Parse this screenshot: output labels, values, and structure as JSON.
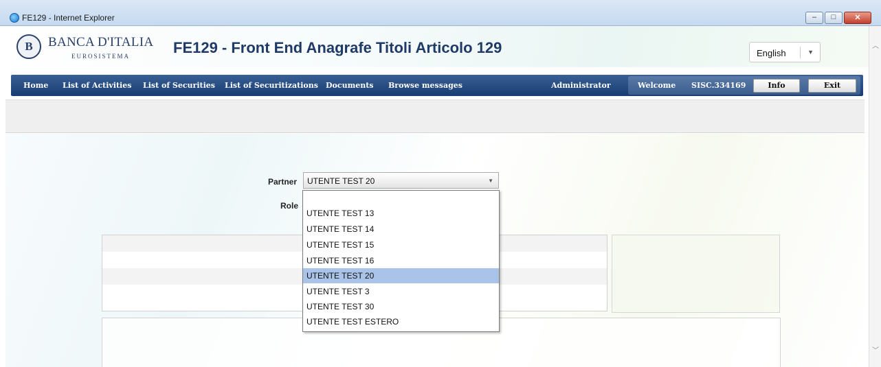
{
  "window": {
    "title": "FE129 - Internet Explorer"
  },
  "header": {
    "bank_name": "BANCA D'ITALIA",
    "bank_subtitle": "EUROSISTEMA",
    "app_title": "FE129 - Front End Anagrafe Titoli Articolo 129",
    "language": "English"
  },
  "nav": {
    "items": [
      "Home",
      "List of Activities",
      "List of Securities",
      "List of Securitizations",
      "Documents",
      "Browse messages"
    ],
    "admin": "Administrator",
    "welcome": "Welcome",
    "user": "SISC.334169",
    "info_button": "Info",
    "exit_button": "Exit"
  },
  "form": {
    "partner_label": "Partner",
    "partner_value": "UTENTE TEST 20",
    "role_label": "Role"
  },
  "partner_dropdown": {
    "options": [
      "",
      "UTENTE TEST 13",
      "UTENTE TEST 14",
      "UTENTE TEST 15",
      "UTENTE TEST 16",
      "UTENTE TEST 20",
      "UTENTE TEST 3",
      "UTENTE TEST 30",
      "UTENTE TEST ESTERO"
    ],
    "selected": "UTENTE TEST 20"
  },
  "colors": {
    "nav_bg": "#1f4677",
    "selected_option": "#a9c4e8",
    "title_text": "#203a67"
  }
}
